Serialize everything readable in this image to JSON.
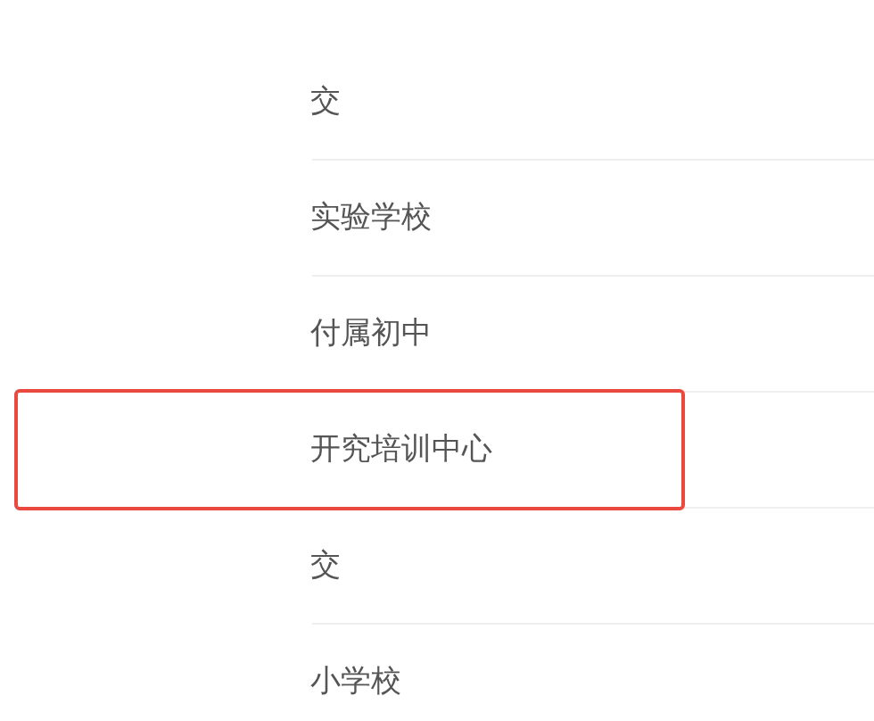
{
  "items": [
    {
      "name": "交",
      "selected": false
    },
    {
      "name": "实验学校",
      "selected": false
    },
    {
      "name": "付属初中",
      "selected": false
    },
    {
      "name": "开究培训中心",
      "selected": true
    },
    {
      "name": "交",
      "selected": false
    },
    {
      "name": "小学校",
      "selected": false
    }
  ]
}
